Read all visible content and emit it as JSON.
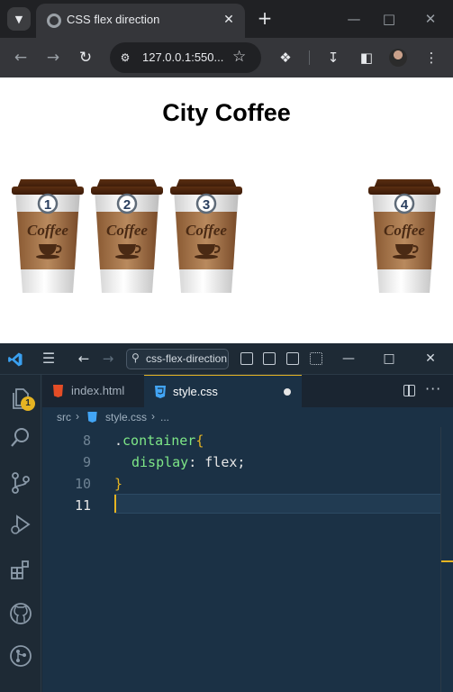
{
  "browser": {
    "tab_title": "CSS flex direction",
    "url": "127.0.0.1:550...",
    "icons": [
      "tab-search-icon",
      "close-icon",
      "plus-icon",
      "minimize-icon",
      "maximize-icon",
      "close-window-icon",
      "back-icon",
      "forward-icon",
      "reload-icon",
      "site-info-icon",
      "star-icon",
      "extensions-icon",
      "download-icon",
      "sidebar-icon",
      "profile-avatar",
      "more-icon"
    ]
  },
  "page": {
    "title": "City Coffee",
    "cups": [
      {
        "number": "1",
        "label": "Coffee"
      },
      {
        "number": "2",
        "label": "Coffee"
      },
      {
        "number": "3",
        "label": "Coffee"
      },
      {
        "number": "4",
        "label": "Coffee"
      }
    ]
  },
  "vscode": {
    "command_center": "css-flex-direction",
    "badge_count": "1",
    "tabs": [
      {
        "label": "index.html",
        "active": false
      },
      {
        "label": "style.css",
        "active": true,
        "modified": true
      }
    ],
    "breadcrumb": [
      "src",
      "style.css",
      "..."
    ],
    "lines": [
      {
        "number": "8",
        "selector_dot": ".",
        "selector": "container",
        "brace": "{"
      },
      {
        "number": "9",
        "property": "display",
        "colon": ": ",
        "value": "flex",
        "semicolon": ";"
      },
      {
        "number": "10",
        "brace": "}"
      },
      {
        "number": "11"
      }
    ],
    "colors": {
      "accent": "#e6b422",
      "selector": "#7ee787",
      "editor_bg": "#1b3145"
    }
  }
}
